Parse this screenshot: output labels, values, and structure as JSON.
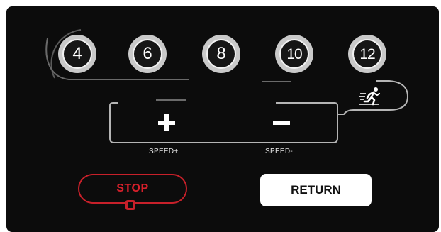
{
  "speed_presets": [
    "4",
    "6",
    "8",
    "10",
    "12"
  ],
  "speed_controls": {
    "increase_caption": "SPEED+",
    "decrease_caption": "SPEED-"
  },
  "buttons": {
    "stop_label": "STOP",
    "return_label": "RETURN"
  },
  "icons": {
    "plus": "plus-icon",
    "minus": "minus-icon",
    "runner": "running-man-icon"
  },
  "colors": {
    "panel": "#0c0c0c",
    "stop_accent": "#c8202a",
    "return_bg": "#ffffff",
    "ring": "#c9c9c9"
  }
}
